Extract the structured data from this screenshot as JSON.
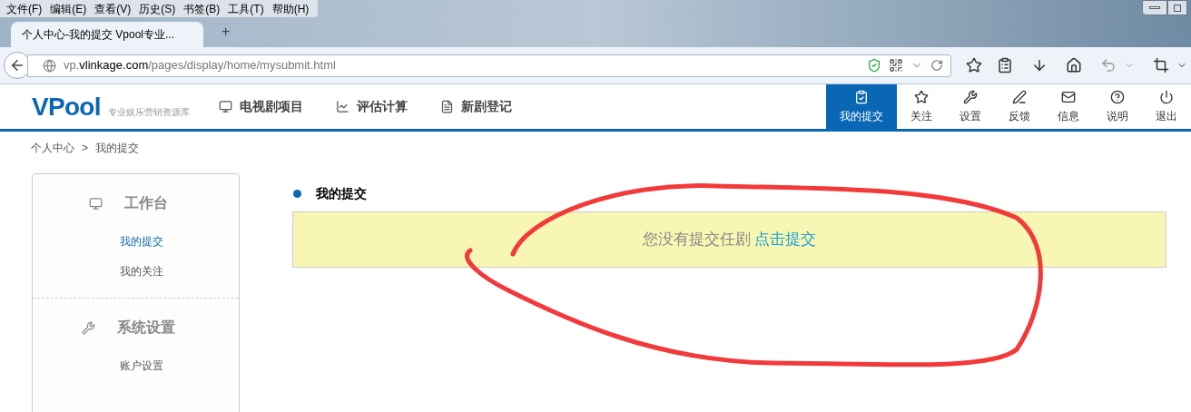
{
  "browser": {
    "menu": [
      "文件(F)",
      "编辑(E)",
      "查看(V)",
      "历史(S)",
      "书签(B)",
      "工具(T)",
      "帮助(H)"
    ],
    "tabs": [
      {
        "label": "个人中心-我的提交 Vpool专业...",
        "selected": true
      }
    ],
    "new_tab": "+",
    "url": {
      "host_pre": "vp.",
      "host": "vlinkage.com",
      "path": "/pages/display/home/mysubmit.html"
    }
  },
  "site": {
    "logo": "VPool",
    "tagline": "专业娱乐营销资源库",
    "nav": [
      {
        "label": "电视剧项目"
      },
      {
        "label": "评估计算"
      },
      {
        "label": "新剧登记"
      }
    ],
    "user_nav": [
      {
        "label": "我的提交",
        "selected": true
      },
      {
        "label": "关注",
        "selected": false
      },
      {
        "label": "设置",
        "selected": false
      },
      {
        "label": "反馈",
        "selected": false
      },
      {
        "label": "信息",
        "selected": false
      },
      {
        "label": "说明",
        "selected": false
      },
      {
        "label": "退出",
        "selected": false
      }
    ]
  },
  "breadcrumb": [
    "个人中心",
    ">",
    "我的提交"
  ],
  "sidebar": {
    "sections": [
      {
        "title": "工作台",
        "items": [
          {
            "label": "我的提交",
            "selected": true
          },
          {
            "label": "我的关注",
            "selected": false
          }
        ]
      },
      {
        "title": "系统设置",
        "items": [
          {
            "label": "账户设置",
            "selected": false
          }
        ]
      }
    ]
  },
  "main": {
    "heading": "我的提交",
    "notice": {
      "text": "您没有提交任剧",
      "link": "点击提交"
    }
  }
}
